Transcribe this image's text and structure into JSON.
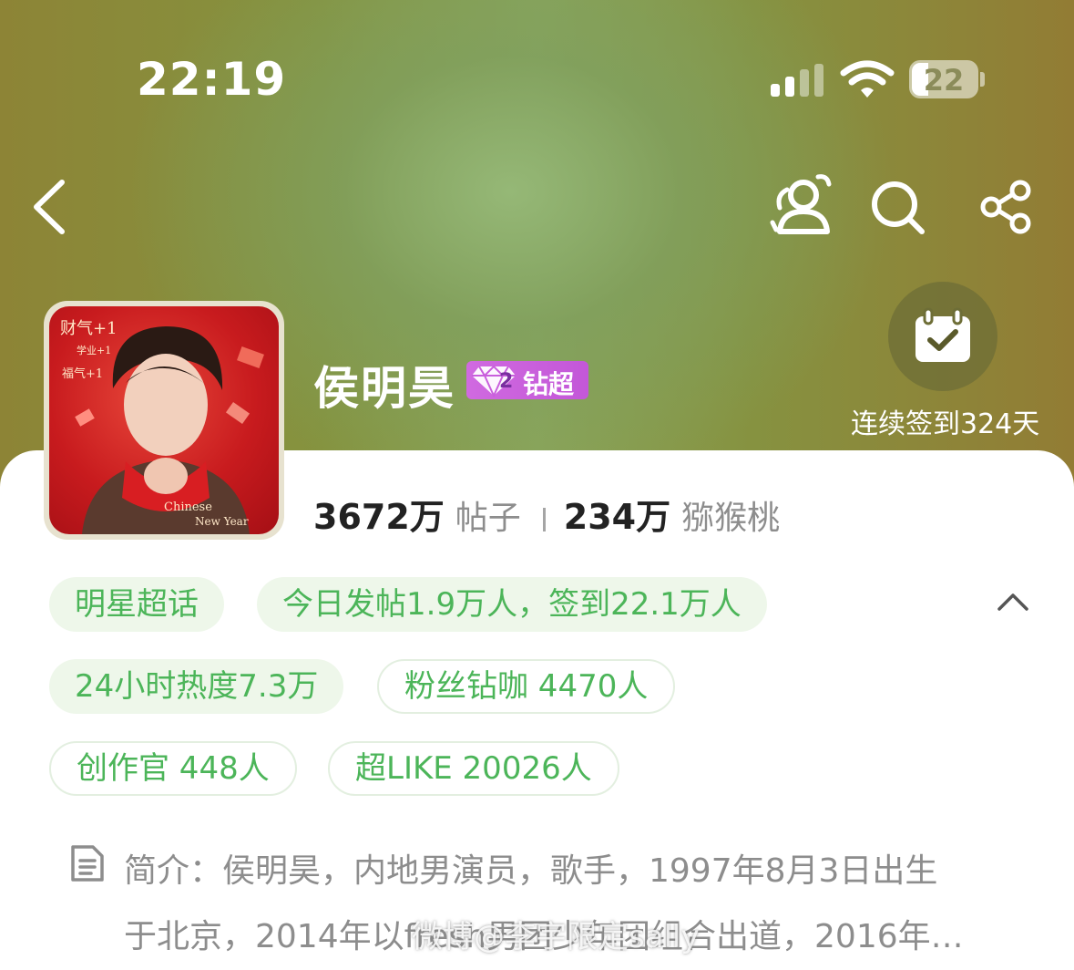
{
  "status_bar": {
    "time": "22:19",
    "battery": "22"
  },
  "nav": {
    "back_icon": "chevron-left-icon",
    "icons": [
      "people-icon",
      "search-icon",
      "share-icon"
    ]
  },
  "profile": {
    "name": "侯明昊",
    "badge_level": "2",
    "badge_label": "钻超",
    "avatar_text": [
      "财气+1",
      "学业+1",
      "福气+1",
      "Chinese",
      "New Year"
    ],
    "checkin_label": "连续签到324天"
  },
  "stats": {
    "posts_value": "3672万",
    "posts_label": "帖子",
    "fans_value": "234万",
    "fans_label": "猕猴桃"
  },
  "tags": {
    "row1": [
      "明星超话",
      "今日发帖1.9万人，签到22.1万人"
    ],
    "row2": [
      "24小时热度7.3万",
      "粉丝钻咖 4470人"
    ],
    "row3": [
      "创作官 448人",
      "超LIKE 20026人"
    ]
  },
  "intro": {
    "line1": "简介：侯明昊，内地男演员，歌手，1997年8月3日出生",
    "line2": "于北京，2014年以fresh男团少年团组合出道，2016年…"
  },
  "watermark": "微博@李宇限定sally",
  "colors": {
    "accent_green": "#4cb559",
    "tag_bg": "#eef7ea",
    "badge_purple": "#c95fdc"
  }
}
